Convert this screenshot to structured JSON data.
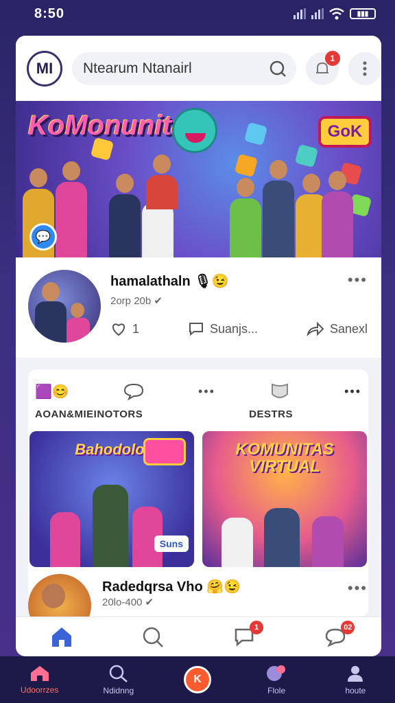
{
  "status_bar": {
    "time": "8:50"
  },
  "header": {
    "logo_text": "MI",
    "search_value": "Ntearum Ntanairl",
    "notification_count": "1"
  },
  "hero": {
    "title": "KoMonunitas!",
    "badge_text": "GoK"
  },
  "post": {
    "name": "hamalathaln",
    "meta": "2orp 20b",
    "likes": "1",
    "comment_label": "Suanjs...",
    "share_label": "Sanexl"
  },
  "section": {
    "left_label": "AOAN&MIEINOTORS",
    "right_label": "DESTRS",
    "thumb_a_title": "Bahodolol",
    "thumb_a_tag": "Suns",
    "thumb_b_title": "KOMUNITAS VIRTUAL",
    "row_name": "Radedqrsa Vho",
    "row_meta": "20lo-400"
  },
  "inner_nav": {
    "chat_badge": "1",
    "alert_badge": "02"
  },
  "bottom_nav": {
    "items": [
      {
        "label": "Udoorrzes"
      },
      {
        "label": "Ndidnng"
      },
      {
        "label": ""
      },
      {
        "label": "Flole"
      },
      {
        "label": "houte"
      }
    ],
    "center_glyph": "K"
  },
  "colors": {
    "accent": "#ff5b2e",
    "badge": "#e53935",
    "nav_bg": "#1d1a4a",
    "active_tab": "#3b63d8"
  }
}
